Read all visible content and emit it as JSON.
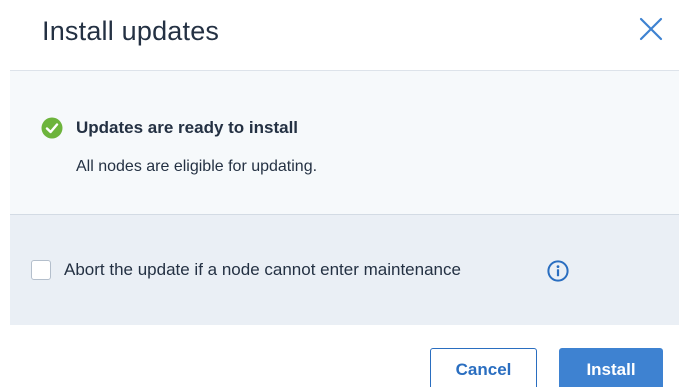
{
  "dialog": {
    "title": "Install updates",
    "close_icon": "close-icon"
  },
  "status": {
    "icon": "check-circle-icon",
    "icon_color": "#6db43c",
    "title": "Updates are ready to install",
    "description": "All nodes are eligible for updating."
  },
  "options": {
    "abort_checkbox_checked": false,
    "abort_label": "Abort the update if a node cannot enter maintenance",
    "info_icon": "info-icon"
  },
  "buttons": {
    "cancel_label": "Cancel",
    "install_label": "Install"
  },
  "colors": {
    "accent": "#3e82d1",
    "text": "#243143"
  }
}
